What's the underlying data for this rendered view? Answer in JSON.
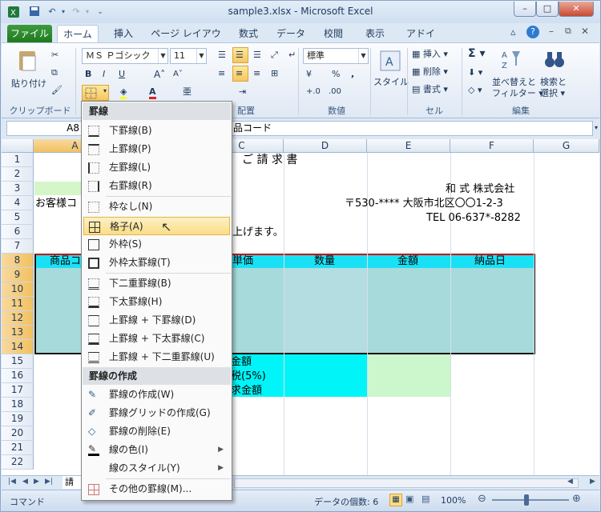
{
  "window": {
    "title": "sample3.xlsx - Microsoft Excel"
  },
  "tabs": [
    "ファイル",
    "ホーム",
    "挿入",
    "ページ レイアウト",
    "数式",
    "データ",
    "校閲",
    "表示",
    "アドイン"
  ],
  "ribbon": {
    "paste_label": "貼り付け",
    "font_name": "ＭＳ Ｐゴシック",
    "font_size": "11",
    "number_format": "標準",
    "style_label": "スタイル",
    "insert_label": "挿入",
    "delete_label": "削除",
    "format_label": "書式",
    "sort_label": "並べ替えと",
    "sort_label2": "フィルター",
    "find_label": "検索と",
    "find_label2": "選択",
    "groups": [
      "クリップボード",
      "配置",
      "数値",
      "セル",
      "編集"
    ]
  },
  "formula_bar": {
    "name_box": "A8",
    "content": "品コード"
  },
  "columns": [
    "A",
    "B",
    "C",
    "D",
    "E",
    "F",
    "G"
  ],
  "rows": [
    "1",
    "2",
    "3",
    "4",
    "5",
    "6",
    "7",
    "8",
    "9",
    "10",
    "11",
    "12",
    "13",
    "14",
    "15",
    "16",
    "17",
    "18",
    "19",
    "20",
    "21",
    "22"
  ],
  "cells": {
    "title": "ご 請 求 書",
    "company": "和 式 株式会社",
    "address": "〒530-**** 大阪市北区〇〇1-2-3",
    "tel": "TEL 06-637*-8282",
    "customer": "お客様コ",
    "message": "上げます。",
    "hdr_code": "商品コ",
    "hdr_price": "単価",
    "hdr_qty": "数量",
    "hdr_amount": "金額",
    "hdr_date": "納品日",
    "r15": "金額",
    "r16": "税(5%)",
    "r17": "求金額"
  },
  "sheet_tab": "請ス",
  "status": {
    "mode": "コマンド",
    "count_label": "データの個数: 6",
    "zoom": "100%"
  },
  "menu": {
    "header1": "罫線",
    "items1": [
      "下罫線(B)",
      "上罫線(P)",
      "左罫線(L)",
      "右罫線(R)",
      "枠なし(N)",
      "格子(A)",
      "外枠(S)",
      "外枠太罫線(T)",
      "下二重罫線(B)",
      "下太罫線(H)",
      "上罫線 + 下罫線(D)",
      "上罫線 + 下太罫線(C)",
      "上罫線 + 下二重罫線(U)"
    ],
    "header2": "罫線の作成",
    "items2": [
      "罫線の作成(W)",
      "罫線グリッドの作成(G)",
      "罫線の削除(E)",
      "線の色(I)",
      "線のスタイル(Y)",
      "その他の罫線(M)..."
    ]
  }
}
